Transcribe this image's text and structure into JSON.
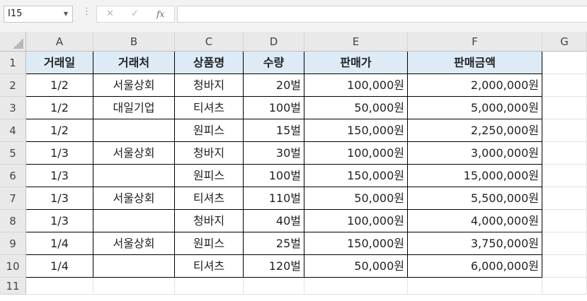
{
  "formula_bar": {
    "name_box": "I15",
    "cancel_icon": "✕",
    "enter_icon": "✓",
    "fx_label": "fx",
    "formula": ""
  },
  "columns": [
    "A",
    "B",
    "C",
    "D",
    "E",
    "F",
    "G"
  ],
  "rows": [
    "1",
    "2",
    "3",
    "4",
    "5",
    "6",
    "7",
    "8",
    "9",
    "10",
    "11"
  ],
  "table": {
    "headers": [
      "거래일",
      "거래처",
      "상품명",
      "수량",
      "판매가",
      "판매금액"
    ],
    "rows": [
      [
        "1/2",
        "서울상회",
        "청바지",
        "20벌",
        "100,000원",
        "2,000,000원"
      ],
      [
        "1/2",
        "대일기업",
        "티셔츠",
        "100벌",
        "50,000원",
        "5,000,000원"
      ],
      [
        "1/2",
        "",
        "원피스",
        "15벌",
        "150,000원",
        "2,250,000원"
      ],
      [
        "1/3",
        "서울상회",
        "청바지",
        "30벌",
        "100,000원",
        "3,000,000원"
      ],
      [
        "1/3",
        "",
        "원피스",
        "100벌",
        "150,000원",
        "15,000,000원"
      ],
      [
        "1/3",
        "서울상회",
        "티셔츠",
        "110벌",
        "50,000원",
        "5,500,000원"
      ],
      [
        "1/3",
        "",
        "청바지",
        "40벌",
        "100,000원",
        "4,000,000원"
      ],
      [
        "1/4",
        "서울상회",
        "원피스",
        "25벌",
        "150,000원",
        "3,750,000원"
      ],
      [
        "1/4",
        "",
        "티셔츠",
        "120벌",
        "50,000원",
        "6,000,000원"
      ]
    ]
  },
  "colors": {
    "header_fill": "#ddebf7",
    "gridline": "#e1e1e1",
    "border": "#000000"
  }
}
